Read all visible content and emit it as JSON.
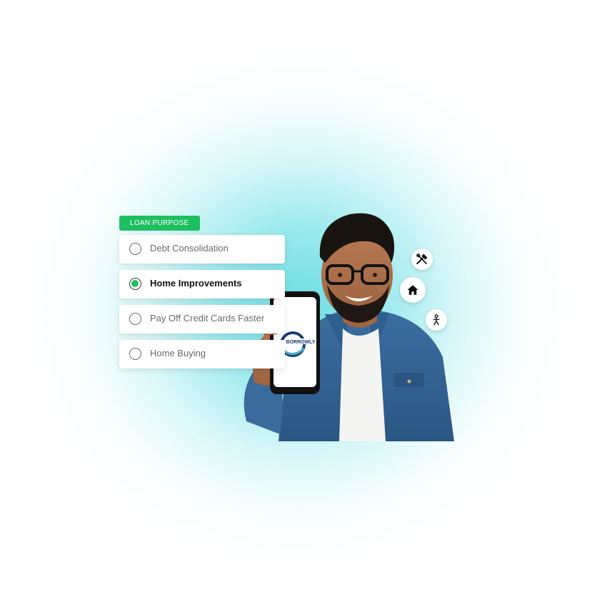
{
  "loan_purpose": {
    "badge_label": "LOAN PURPOSE",
    "options": [
      {
        "label": "Debt Consolidation",
        "selected": false
      },
      {
        "label": "Home Improvements",
        "selected": true
      },
      {
        "label": "Pay Off Credit Cards Faster",
        "selected": false
      },
      {
        "label": "Home Buying",
        "selected": false
      }
    ]
  },
  "phone": {
    "logo_text": "BORROWLY"
  },
  "floating_icons": [
    "tools-icon",
    "home-icon",
    "person-icon"
  ],
  "colors": {
    "accent": "#1dbf5f",
    "glow": "#52d7de",
    "logo": "#1d3d7a"
  }
}
